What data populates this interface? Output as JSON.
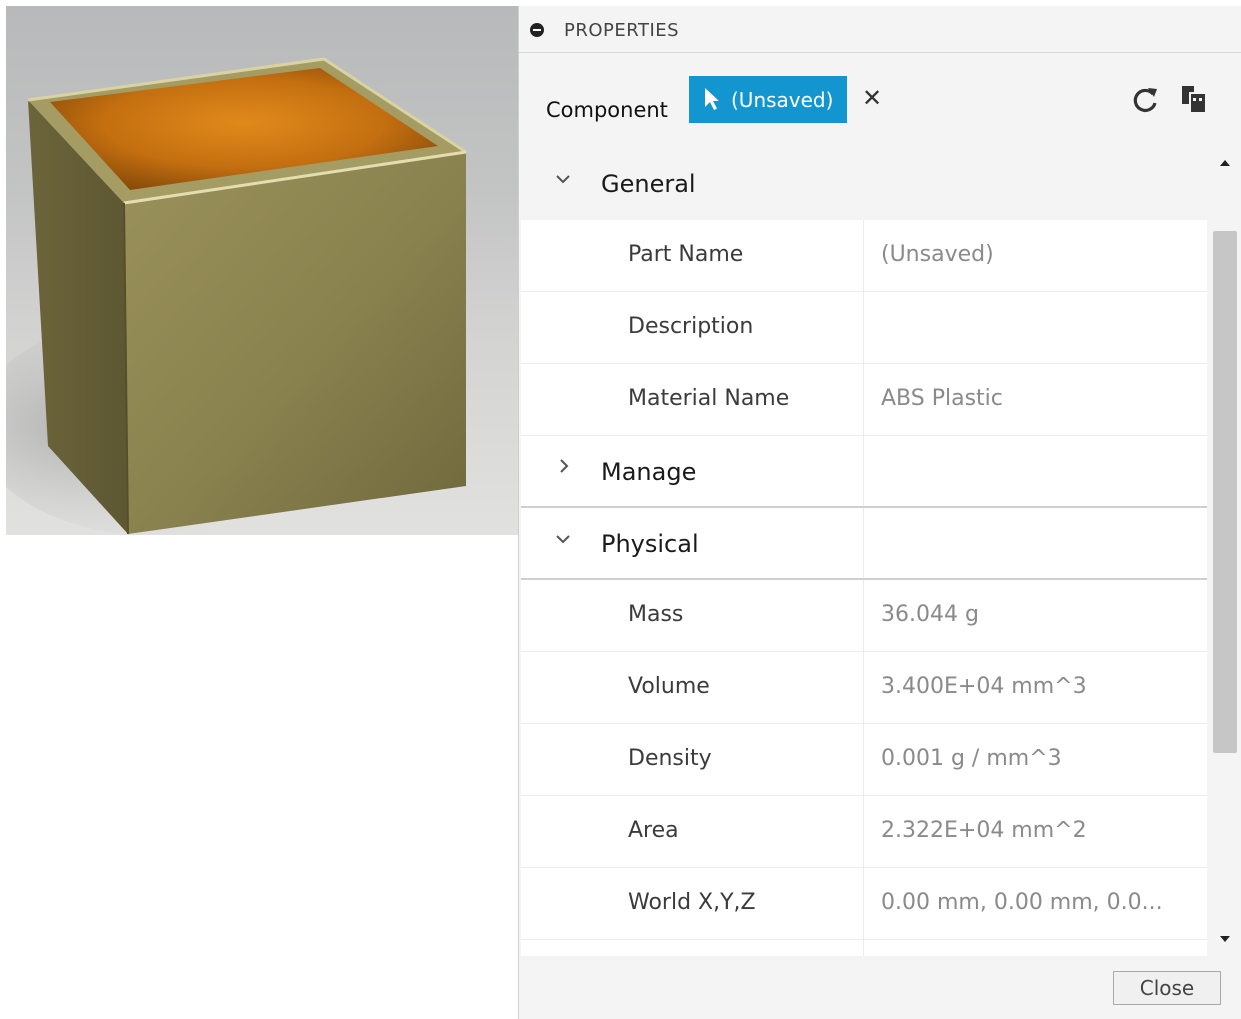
{
  "panel": {
    "title": "PROPERTIES",
    "component_label": "Component",
    "selection_label": "(Unsaved)",
    "close_label": "Close"
  },
  "sections": {
    "general": {
      "label": "General",
      "rows": [
        {
          "name": "Part Name",
          "value": "(Unsaved)"
        },
        {
          "name": "Description",
          "value": ""
        },
        {
          "name": "Material Name",
          "value": "ABS Plastic"
        }
      ]
    },
    "manage": {
      "label": "Manage"
    },
    "physical": {
      "label": "Physical",
      "rows": [
        {
          "name": "Mass",
          "value": "36.044 g"
        },
        {
          "name": "Volume",
          "value": "3.400E+04 mm^3"
        },
        {
          "name": "Density",
          "value": "0.001 g / mm^3"
        },
        {
          "name": "Area",
          "value": "2.322E+04 mm^2"
        },
        {
          "name": "World X,Y,Z",
          "value": "0.00 mm, 0.00 mm, 0.0..."
        }
      ]
    }
  },
  "colors": {
    "accent": "#1396d0",
    "model_gold": "#8c8450",
    "model_interior": "#d07a14"
  },
  "icons": [
    "collapse-icon",
    "cursor-icon",
    "clear-icon",
    "refresh-icon",
    "copy-icon",
    "chevron-down-icon",
    "chevron-right-icon",
    "scroll-up-icon",
    "scroll-down-icon"
  ]
}
